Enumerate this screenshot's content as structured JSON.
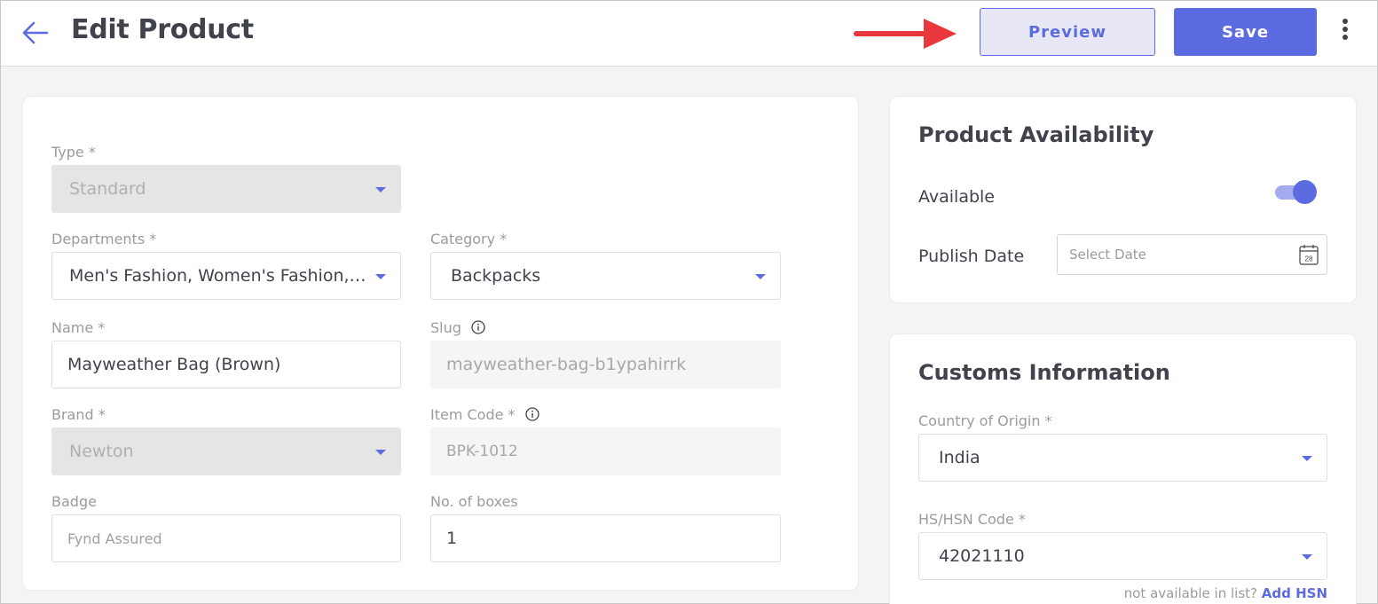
{
  "header": {
    "title": "Edit Product",
    "preview_label": "Preview",
    "save_label": "Save"
  },
  "colors": {
    "accent": "#5c6bdf",
    "annotation_arrow": "#e8383d"
  },
  "icons": {
    "back": "arrow-left-icon",
    "more": "kebab-menu-icon",
    "calendar": "calendar-icon",
    "info": "info-icon",
    "dropdown": "chevron-down-icon"
  },
  "form": {
    "type_label": "Type *",
    "type_value": "Standard",
    "departments_label": "Departments *",
    "departments_value": "Men's Fashion, Women's Fashion, K...",
    "category_label": "Category *",
    "category_value": "Backpacks",
    "name_label": "Name *",
    "name_value": "Mayweather Bag (Brown)",
    "slug_label": "Slug",
    "slug_value": "mayweather-bag-b1ypahirrk",
    "brand_label": "Brand *",
    "brand_value": "Newton",
    "item_code_label": "Item Code *",
    "item_code_value": "BPK-1012",
    "badge_label": "Badge",
    "badge_value": "Fynd Assured",
    "boxes_label": "No. of boxes",
    "boxes_value": "1"
  },
  "availability": {
    "title": "Product Availability",
    "available_label": "Available",
    "available_on": true,
    "publish_label": "Publish Date",
    "publish_placeholder": "Select Date",
    "calendar_day": "28"
  },
  "customs": {
    "title": "Customs Information",
    "country_label": "Country of Origin *",
    "country_value": "India",
    "hsn_label": "HS/HSN Code *",
    "hsn_value": "42021110",
    "hint_text": "not available in list?",
    "add_hsn_label": "Add HSN"
  }
}
